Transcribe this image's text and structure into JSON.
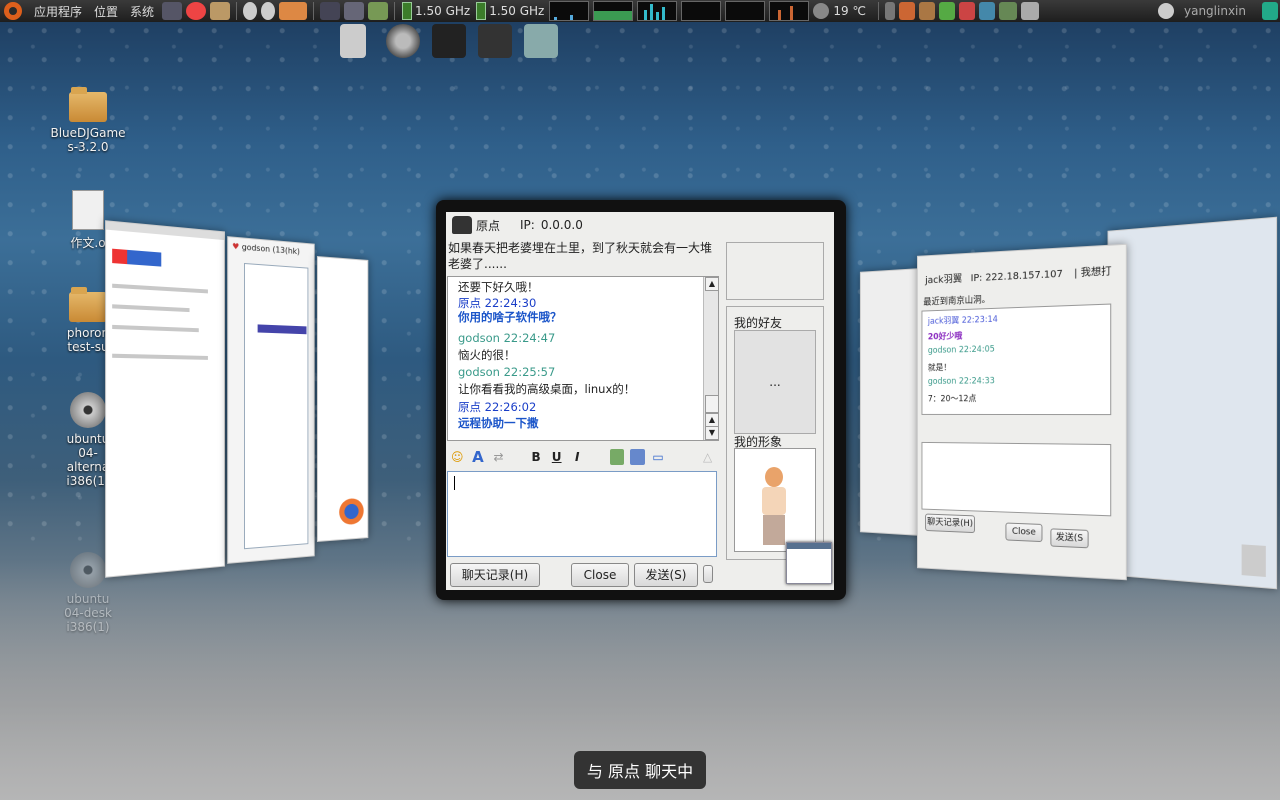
{
  "panel": {
    "menus": [
      "应用程序",
      "位置",
      "系统"
    ],
    "cpu1": "1.50 GHz",
    "cpu2": "1.50 GHz",
    "temperature": "19 ℃",
    "user": "yanglinxin"
  },
  "desktop": {
    "icons": [
      {
        "label1": "BlueDJGame",
        "label2": "s-3.2.0"
      },
      {
        "label1": "作文.o",
        "label2": ""
      },
      {
        "label1": "phoron",
        "label2": "test-su"
      },
      {
        "label1": "ubuntu",
        "label2": "04-",
        "label3": "alterna",
        "label4": "i386(1)"
      },
      {
        "label1": "ubuntu",
        "label2": "04-desk",
        "label3": "i386(1)"
      }
    ]
  },
  "chat": {
    "contact_name": "原点",
    "ip_label": "IP:",
    "ip_value": "0.0.0.0",
    "signature": "如果春天把老婆埋在土里，到了秋天就会有一大堆老婆了......",
    "messages": [
      {
        "kind": "text",
        "text": "还要下好久哦！"
      },
      {
        "kind": "name1",
        "text": "原点 22:24:30"
      },
      {
        "kind": "big",
        "text": "你用的啥子软件哦？"
      },
      {
        "kind": "name2",
        "text": "godson 22:24:47"
      },
      {
        "kind": "text",
        "text": "恼火的很！"
      },
      {
        "kind": "name2",
        "text": "godson 22:25:57"
      },
      {
        "kind": "text",
        "text": "让你看看我的高级桌面，linux的！"
      },
      {
        "kind": "name1",
        "text": "原点 22:26:02"
      },
      {
        "kind": "big",
        "text": "远程协助一下撒"
      }
    ],
    "friends_label": "我的好友",
    "friends_more": "...",
    "avatar_label": "我的形象",
    "history_button": "聊天记录(H)",
    "close_button": "Close",
    "send_button": "发送(S)"
  },
  "right_chat": {
    "contact_name": "jack羽翼",
    "ip_label": "IP:",
    "ip_value": "222.18.157.107",
    "signature": "| 我想打",
    "subtitle": "最近到南京山洞。",
    "lines": [
      {
        "cls": "name1",
        "text": "jack羽翼 22:23:14"
      },
      {
        "cls": "purple",
        "text": "20好少哦"
      },
      {
        "cls": "name2",
        "text": "godson 22:24:05"
      },
      {
        "cls": "text",
        "text": "就是！"
      },
      {
        "cls": "name2",
        "text": "godson 22:24:33"
      },
      {
        "cls": "text",
        "text": "7：20～12点"
      }
    ],
    "history_button": "聊天记录(H)",
    "close_button": "Close",
    "send_button": "发送(S"
  },
  "left_chat": {
    "title": "godson",
    "subtitle": "(13(hk)"
  },
  "osd": {
    "text": "与 原点 聊天中"
  },
  "colors": {
    "name1": "#1a3ec8",
    "name2": "#3a9a8a",
    "accent": "#dd5f1c"
  }
}
